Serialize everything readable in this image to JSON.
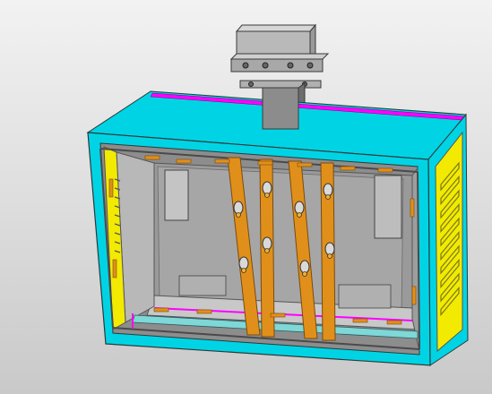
{
  "viewport": {
    "background_top": "#f2f2f2",
    "background_bottom": "#c9c9c9"
  },
  "model": {
    "colors": {
      "frame": "#00d4e4",
      "frame_dark": "#0aa8b8",
      "frame_edge": "#2a3a3a",
      "top_strip": "#ff00ff",
      "side_panel": "#f2ea00",
      "vents": "#7a7a20",
      "bars": "#e0901a",
      "bars_edge": "#7a4a10",
      "interior": "#9a9a9a",
      "interior_light": "#c8c8c8",
      "bracket": "#b8b8b8",
      "bracket_edge": "#3a3a3a",
      "rail": "#8a8a8a"
    },
    "parts": [
      {
        "name": "mounting-bracket-top",
        "visible": true
      },
      {
        "name": "support-post",
        "visible": true
      },
      {
        "name": "cabinet-frame",
        "visible": true
      },
      {
        "name": "side-vent-panel-right",
        "visible": true
      },
      {
        "name": "side-vent-panel-left",
        "visible": true
      },
      {
        "name": "diagonal-brace-bars",
        "visible": true
      },
      {
        "name": "interior-back-panel",
        "visible": true
      }
    ],
    "vent_count_right": 10,
    "brace_bar_count": 4
  }
}
